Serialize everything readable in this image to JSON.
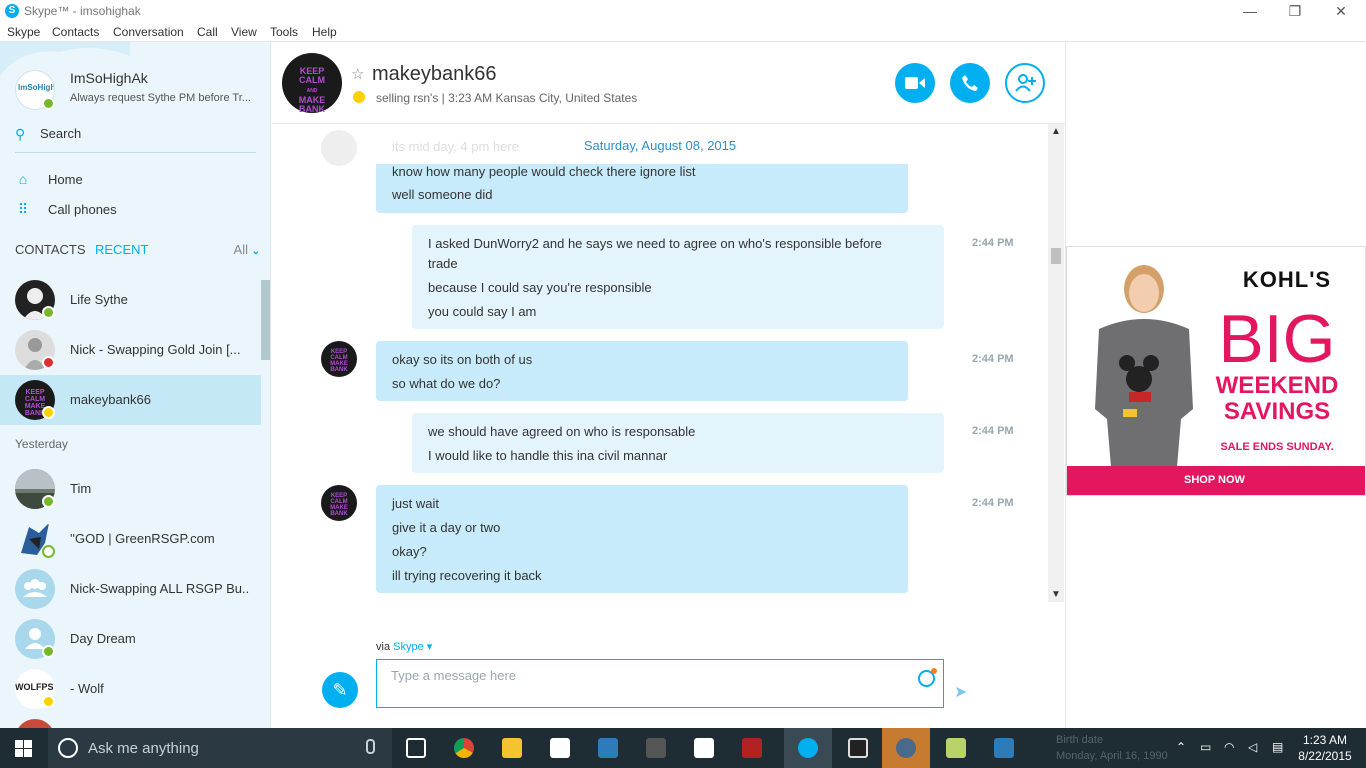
{
  "window": {
    "title": "Skype™ - imsohighak",
    "minimize": "—",
    "restore": "❐",
    "close": "✕"
  },
  "menu": [
    "Skype",
    "Contacts",
    "Conversation",
    "Call",
    "View",
    "Tools",
    "Help"
  ],
  "profile": {
    "name": "ImSoHighAk",
    "mood": "Always request Sythe PM before Tr...",
    "avatar_text": "ImSoHighAk"
  },
  "search": {
    "label": "Search"
  },
  "nav": {
    "home": "Home",
    "call_phones": "Call phones"
  },
  "contact_tabs": {
    "contacts": "CONTACTS",
    "recent": "RECENT",
    "filter": "All"
  },
  "recent_contacts": [
    {
      "name": "Life Sythe",
      "status": "online"
    },
    {
      "name": "Nick - Swapping Gold Join [...",
      "status": "busy"
    },
    {
      "name": "makeybank66",
      "status": "away",
      "selected": true
    }
  ],
  "yesterday_label": "Yesterday",
  "yesterday_contacts": [
    {
      "name": "Tim",
      "status": "online"
    },
    {
      "name": "''GOD | GreenRSGP.com",
      "status": "offline"
    },
    {
      "name": "Nick-Swapping ALL RSGP Bu...",
      "status": "group"
    },
    {
      "name": "Day Dream",
      "status": "online"
    },
    {
      "name": "- Wolf",
      "status": "away",
      "avatar_text": "WOLFPS"
    }
  ],
  "conversation": {
    "name": "makeybank66",
    "subtitle": "selling rsn's  |  3:23 AM Kansas City, United States",
    "avatar_text": [
      "KEEP",
      "CALM",
      "AND",
      "MAKE",
      "BANK"
    ]
  },
  "date_separator": "Saturday, August 08, 2015",
  "ghost_line": "its mid day, 4 pm here",
  "messages": [
    {
      "from": "them",
      "lines": [
        "know how many people would check there ignore list",
        "well someone did"
      ],
      "time": ""
    },
    {
      "from": "me",
      "lines": [
        "I asked DunWorry2 and he says we need to agree on who's responsible before",
        "trade",
        "because I could say you're responsible",
        "you could say I am"
      ],
      "time": "2:44 PM"
    },
    {
      "from": "them",
      "lines": [
        "okay so its on both of us",
        "so what do we do?"
      ],
      "time": "2:44 PM"
    },
    {
      "from": "me",
      "lines": [
        "we should have agreed on who is responsable",
        "I would like to handle this ina  civil mannar"
      ],
      "time": "2:44 PM"
    },
    {
      "from": "them",
      "lines": [
        "just wait",
        "give it a day or two",
        "okay?",
        "ill trying recovering it back"
      ],
      "time": "2:44 PM"
    }
  ],
  "composer": {
    "via": "via",
    "via_service": "Skype",
    "placeholder": "Type a message here"
  },
  "ad": {
    "brand": "KOHL'S",
    "headline": "BIG",
    "subheadline_1": "WEEKEND",
    "subheadline_2": "SAVINGS",
    "note": "SALE ENDS SUNDAY.",
    "cta": "SHOP NOW"
  },
  "taskbar": {
    "search_placeholder": "Ask me anything",
    "clock_time": "1:23 AM",
    "clock_date": "8/22/2015",
    "ghost_1": "Birth date",
    "ghost_2": "Monday, April 16, 1990"
  },
  "colors": {
    "accent": "#00aff0",
    "bubble_in": "#c7ebfa",
    "bubble_out": "#e3f4fc",
    "ad_pink": "#e3175f"
  }
}
